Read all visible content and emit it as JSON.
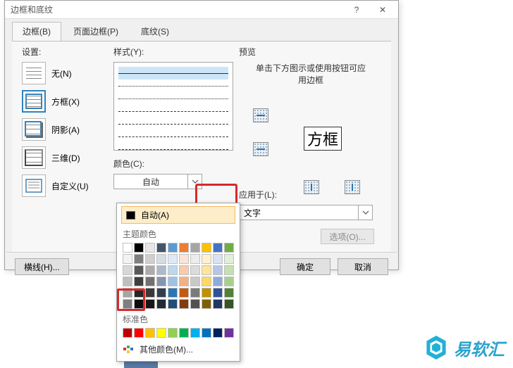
{
  "dialog": {
    "title": "边框和底纹",
    "tabs": {
      "border": "边框(B)",
      "page_border": "页面边框(P)",
      "shading": "底纹(S)"
    },
    "setting": {
      "label": "设置:",
      "none": "无(N)",
      "box": "方框(X)",
      "shadow": "阴影(A)",
      "three_d": "三维(D)",
      "custom": "自定义(U)"
    },
    "style": {
      "label": "样式(Y):",
      "color_label": "颜色(C):",
      "color_value": "自动"
    },
    "preview": {
      "label": "预览",
      "hint": "单击下方图示或使用按钮可应用边框",
      "sample_text": "方框",
      "apply_label": "应用于(L):",
      "apply_value": "文字",
      "options_btn": "选项(O)..."
    },
    "footer": {
      "hlines": "横线(H)...",
      "ok": "确定",
      "cancel": "取消"
    }
  },
  "colorpicker": {
    "auto": "自动(A)",
    "theme_label": "主题颜色",
    "standard_label": "标准色",
    "more": "其他颜色(M)...",
    "theme_colors": [
      "#ffffff",
      "#000000",
      "#e7e6e6",
      "#44546a",
      "#5b9bd5",
      "#ed7d31",
      "#a5a5a5",
      "#ffc000",
      "#4472c4",
      "#70ad47",
      "#f2f2f2",
      "#7f7f7f",
      "#d0cece",
      "#d6dce4",
      "#deebf6",
      "#fbe5d5",
      "#ededed",
      "#fff2cc",
      "#d9e2f3",
      "#e2efd9",
      "#d8d8d8",
      "#595959",
      "#aeabab",
      "#adb9ca",
      "#bdd7ee",
      "#f7cbac",
      "#dbdbdb",
      "#fee599",
      "#b4c6e7",
      "#c5e0b3",
      "#bfbfbf",
      "#3f3f3f",
      "#757070",
      "#8496b0",
      "#9cc3e5",
      "#f4b183",
      "#c9c9c9",
      "#ffd965",
      "#8eaadb",
      "#a8d08d",
      "#a5a5a5",
      "#262626",
      "#3a3838",
      "#323f4f",
      "#2e75b5",
      "#c55a11",
      "#7b7b7b",
      "#bf9000",
      "#2f5496",
      "#538135",
      "#7f7f7f",
      "#0c0c0c",
      "#171616",
      "#222a35",
      "#1e4e79",
      "#833c0b",
      "#525252",
      "#7f6000",
      "#1f3864",
      "#375623"
    ],
    "standard_colors": [
      "#c00000",
      "#ff0000",
      "#ffc000",
      "#ffff00",
      "#92d050",
      "#00b050",
      "#00b0f0",
      "#0070c0",
      "#002060",
      "#7030a0"
    ]
  },
  "watermark": {
    "text": "易软汇"
  }
}
